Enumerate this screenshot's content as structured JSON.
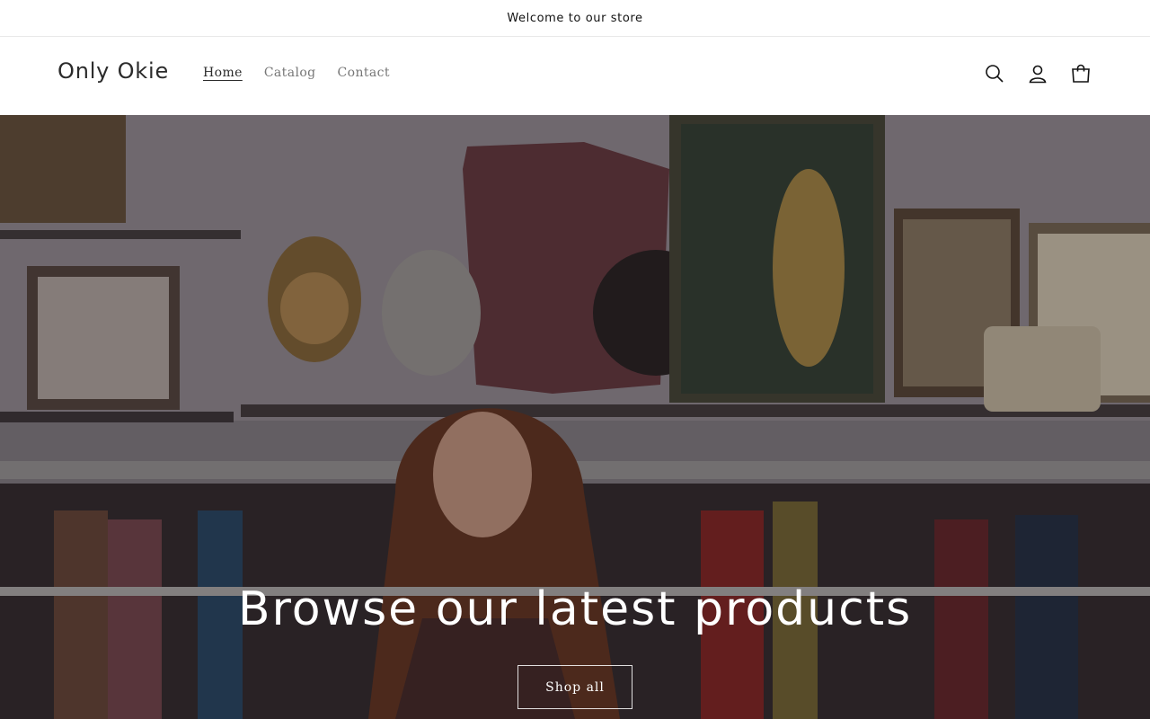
{
  "announcement": {
    "text": "Welcome to our store"
  },
  "header": {
    "logo": "Only Okie",
    "nav": [
      {
        "label": "Home",
        "active": true
      },
      {
        "label": "Catalog",
        "active": false
      },
      {
        "label": "Contact",
        "active": false
      }
    ],
    "icons": [
      "search-icon",
      "account-icon",
      "cart-icon"
    ]
  },
  "hero": {
    "title": "Browse our latest products",
    "button_label": "Shop all"
  },
  "colors": {
    "text": "#121212",
    "nav_muted": "#767676",
    "hero_text": "#ffffff"
  }
}
